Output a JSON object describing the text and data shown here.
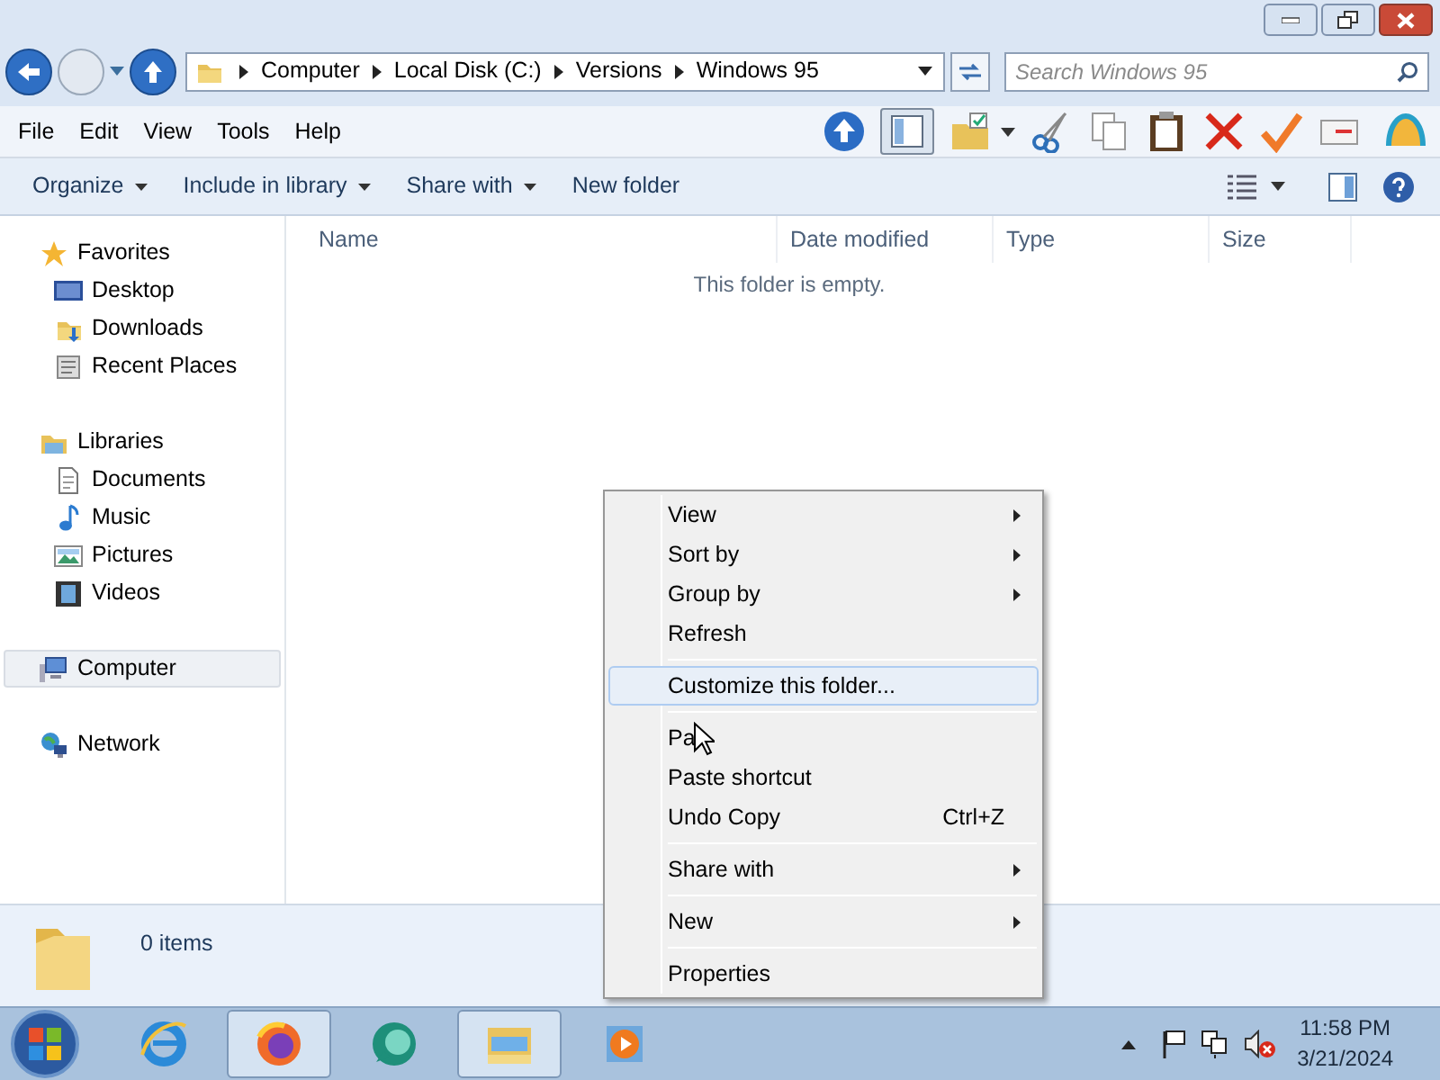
{
  "address_bar": {
    "path": [
      "Computer",
      "Local Disk (C:)",
      "Versions",
      "Windows 95"
    ]
  },
  "search": {
    "placeholder": "Search Windows 95"
  },
  "menu_bar": [
    "File",
    "Edit",
    "View",
    "Tools",
    "Help"
  ],
  "command_bar": [
    {
      "label": "Organize",
      "dropdown": true
    },
    {
      "label": "Include in library",
      "dropdown": true
    },
    {
      "label": "Share with",
      "dropdown": true
    },
    {
      "label": "New folder",
      "dropdown": false
    }
  ],
  "sidebar": {
    "groups": [
      {
        "label": "Favorites",
        "kind": "star",
        "selected": false,
        "children": [
          {
            "label": "Desktop",
            "kind": "desktop"
          },
          {
            "label": "Downloads",
            "kind": "downloads"
          },
          {
            "label": "Recent Places",
            "kind": "recent"
          }
        ]
      },
      {
        "label": "Libraries",
        "kind": "library",
        "selected": false,
        "children": [
          {
            "label": "Documents",
            "kind": "document"
          },
          {
            "label": "Music",
            "kind": "music"
          },
          {
            "label": "Pictures",
            "kind": "pictures"
          },
          {
            "label": "Videos",
            "kind": "videos"
          }
        ]
      },
      {
        "label": "Computer",
        "kind": "computer",
        "selected": true
      },
      {
        "label": "Network",
        "kind": "network",
        "selected": false
      }
    ]
  },
  "columns": [
    "Name",
    "Date modified",
    "Type",
    "Size"
  ],
  "empty_message": "This folder is empty.",
  "context_menu": {
    "groups": [
      [
        {
          "label": "View",
          "submenu": true,
          "selected": false
        },
        {
          "label": "Sort by",
          "submenu": true,
          "selected": false
        },
        {
          "label": "Group by",
          "submenu": true,
          "selected": false
        },
        {
          "label": "Refresh",
          "submenu": false,
          "selected": false
        }
      ],
      [
        {
          "label": "Customize this folder...",
          "submenu": false,
          "selected": true
        }
      ],
      [
        {
          "label": "Pa",
          "submenu": false,
          "selected": false
        },
        {
          "label": "Paste shortcut",
          "submenu": false,
          "selected": false
        },
        {
          "label": "Undo Copy",
          "shortcut": "Ctrl+Z",
          "submenu": false,
          "selected": false
        }
      ],
      [
        {
          "label": "Share with",
          "submenu": true,
          "selected": false
        }
      ],
      [
        {
          "label": "New",
          "submenu": true,
          "selected": false
        }
      ],
      [
        {
          "label": "Properties",
          "submenu": false,
          "selected": false
        }
      ]
    ]
  },
  "status_bar": {
    "count": "0 items"
  },
  "taskbar": {
    "apps": [
      {
        "kind": "browser-e",
        "active": false
      },
      {
        "kind": "firefox",
        "active": true
      },
      {
        "kind": "chat",
        "active": false
      },
      {
        "kind": "explorer",
        "active": true
      },
      {
        "kind": "media",
        "active": false
      }
    ],
    "time": "11:58 PM",
    "date": "3/21/2024"
  }
}
